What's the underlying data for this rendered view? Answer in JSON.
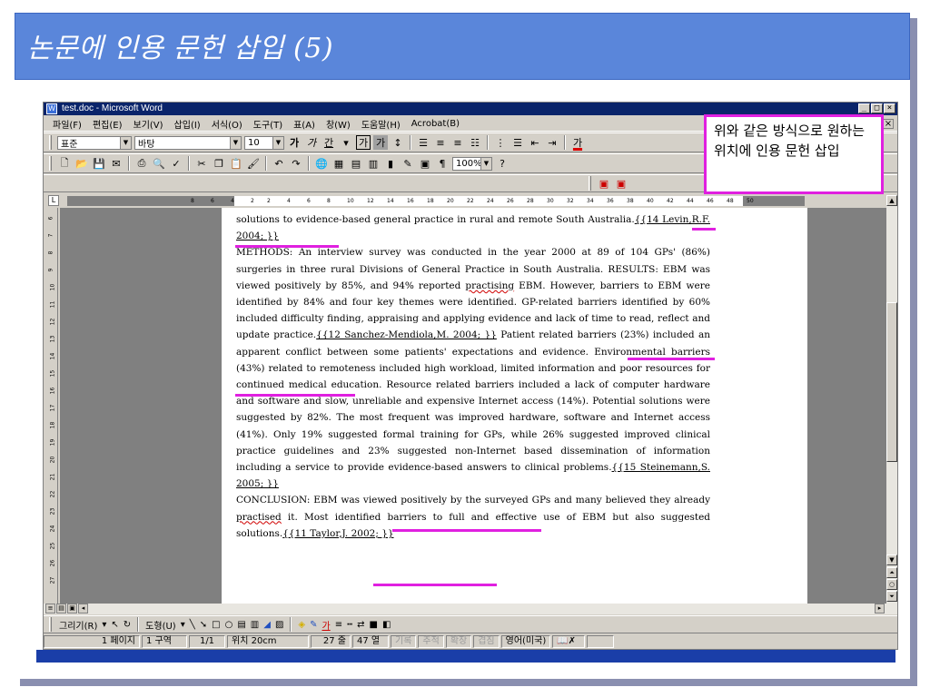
{
  "slide": {
    "title": "논문에 인용 문헌 삽입 (5)"
  },
  "window": {
    "title": "test.doc - Microsoft Word",
    "controls": [
      "_",
      "□",
      "×"
    ]
  },
  "menu": [
    "파일(F)",
    "편집(E)",
    "보기(V)",
    "삽입(I)",
    "서식(O)",
    "도구(T)",
    "표(A)",
    "창(W)",
    "도움말(H)",
    "Acrobat(B)"
  ],
  "formatting": {
    "style": "표준",
    "font": "바탕",
    "size": "10",
    "bold": "가",
    "italic": "가",
    "underline": "간",
    "font_color": "가"
  },
  "standard": {
    "zoom": "100%"
  },
  "ruler": {
    "numbers": [
      "8",
      "6",
      "4",
      "2",
      "2",
      "4",
      "6",
      "8",
      "10",
      "12",
      "14",
      "16",
      "18",
      "20",
      "22",
      "24",
      "26",
      "28",
      "30",
      "32",
      "34",
      "36",
      "38",
      "40",
      "42",
      "44",
      "46",
      "48",
      "50"
    ]
  },
  "vruler": [
    "6",
    "7",
    "8",
    "9",
    "10",
    "11",
    "12",
    "13",
    "14",
    "15",
    "16",
    "17",
    "18",
    "19",
    "20",
    "21",
    "22",
    "23",
    "24",
    "25",
    "26",
    "27"
  ],
  "document": {
    "p1_text": "solutions to evidence-based general practice in rural and remote South Australia.",
    "cite1": "{{14 Levin,R.F. 2004; }}",
    "p2": "METHODS: An interview survey was conducted in the year 2000 at 89 of 104 GPs' (86%) surgeries in three rural Divisions of General Practice in South Australia. RESULTS: EBM was viewed positively by 85%, and 94% reported ",
    "p2_squiggle": "practising",
    "p2b": " EBM. However, barriers to EBM were identified by 84% and four key themes were identified. GP-related barriers identified by 60% included difficulty finding, appraising and applying evidence and lack of time to read, reflect and update practice.",
    "cite2": "{{12 Sanchez-Mendiola,M. 2004; }}",
    "p2c": " Patient related barriers (23%) included an apparent conflict between some patients' expectations and evidence. Environmental barriers (43%) related to remoteness included high workload, limited information and poor resources for continued medical education. Resource related barriers included a lack of computer hardware and software and slow, unreliable and expensive Internet access (14%). Potential solutions were suggested by 82%. The most frequent was improved hardware, software and Internet access (41%). Only 19% suggested formal training for GPs, while 26% suggested improved clinical practice guidelines and 23% suggested non-Internet based dissemination of information including a service to provide evidence-based answers to clinical problems.",
    "cite3": "{{15 Steinemann,S. 2005; }}",
    "p3a": " CONCLUSION: EBM was viewed positively by the surveyed GPs and many believed they already ",
    "p3_squiggle": "practised",
    "p3b": " it. Most identified barriers to full and effective use of EBM but also suggested solutions.",
    "cite4": "{{11 Taylor,J. 2002; }}"
  },
  "callout": {
    "text": "위와 같은 방식으로 원하는 위치에 인용 문헌 삽입"
  },
  "drawing": {
    "draw_menu": "그리기(R)",
    "autoshapes": "도형(U)"
  },
  "status": {
    "page": "1 페이지",
    "section": "1 구역",
    "pages": "1/1",
    "position": "위치 20cm",
    "line": "27 줄",
    "col": "47 열",
    "rec": "기록",
    "trk": "추적",
    "ext": "확장",
    "ovr": "겹침",
    "lang": "영어(미국)"
  },
  "colors": {
    "slide_title_bg": "#5a86da",
    "callout_border": "#e020e0",
    "word_titlebar": "#0a246a"
  }
}
